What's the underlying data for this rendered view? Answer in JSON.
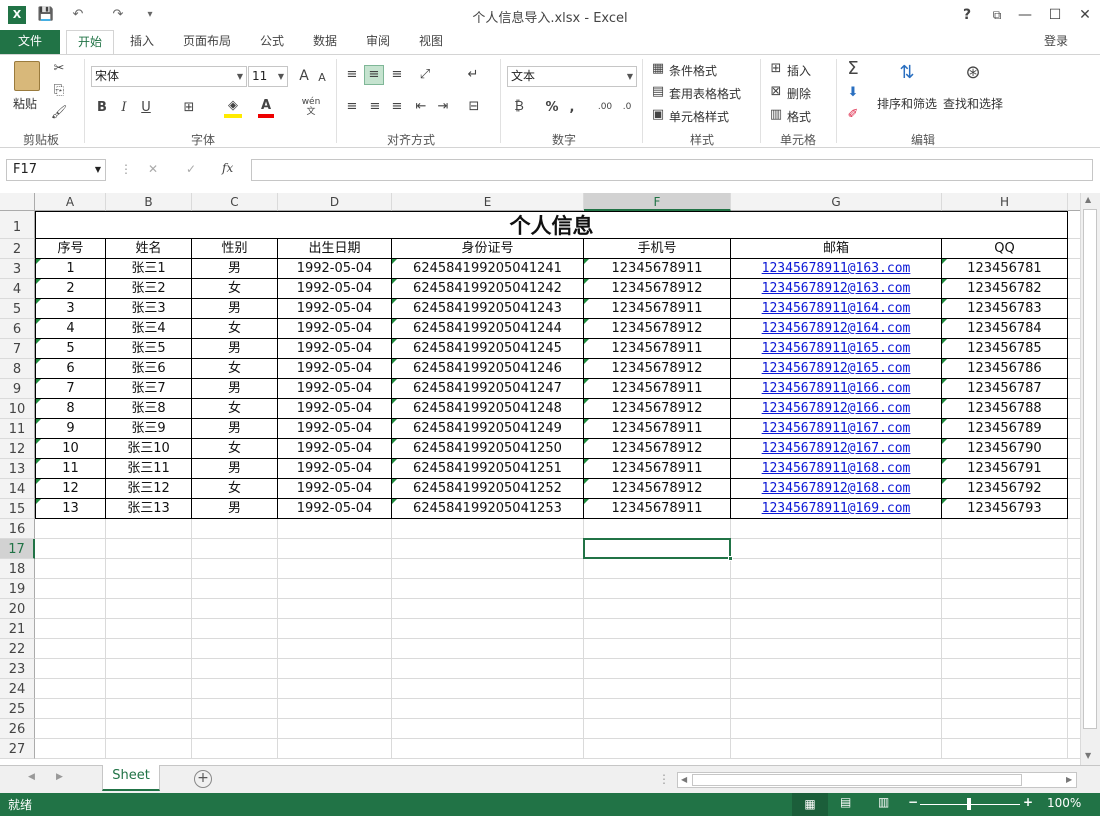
{
  "window": {
    "title": "个人信息导入.xlsx - Excel",
    "help": "?",
    "restore_ribbon": "⧉",
    "minimize": "—",
    "maximize": "☐",
    "close": "✕",
    "login": "登录"
  },
  "quick_access": {
    "save": "💾",
    "undo": "↶",
    "redo": "↷",
    "customize": "▾"
  },
  "tabs": [
    "文件",
    "开始",
    "插入",
    "页面布局",
    "公式",
    "数据",
    "审阅",
    "视图"
  ],
  "ribbon": {
    "clipboard": {
      "paste": "粘贴",
      "group": "剪贴板"
    },
    "font": {
      "name": "宋体",
      "size": "11",
      "group": "字体",
      "bold": "B",
      "italic": "I",
      "underline": "U",
      "grow": "A",
      "shrink": "A",
      "wen": "wén文",
      "font_color": "A"
    },
    "alignment": {
      "group": "对齐方式"
    },
    "number": {
      "format": "文本",
      "group": "数字",
      "percent": "%",
      "comma": ","
    },
    "styles": {
      "conditional": "条件格式",
      "table": "套用表格格式",
      "cell_styles": "单元格样式",
      "group": "样式"
    },
    "cells": {
      "insert": "插入",
      "delete": "删除",
      "format": "格式",
      "group": "单元格"
    },
    "editing": {
      "sort_filter": "排序和筛选",
      "find_select": "查找和选择",
      "group": "编辑"
    }
  },
  "formula_bar": {
    "name_box": "F17",
    "fx": "fx",
    "cancel": "✕",
    "enter": "✓",
    "value": ""
  },
  "columns": [
    "A",
    "B",
    "C",
    "D",
    "E",
    "F",
    "G",
    "H"
  ],
  "selected_column": "F",
  "selected_row": 17,
  "rows": [
    1,
    2,
    3,
    4,
    5,
    6,
    7,
    8,
    9,
    10,
    11,
    12,
    13,
    14,
    15,
    16,
    17,
    18,
    19,
    20,
    21,
    22,
    23,
    24,
    25,
    26,
    27
  ],
  "sheet_title": "个人信息",
  "headers": [
    "序号",
    "姓名",
    "性别",
    "出生日期",
    "身份证号",
    "手机号",
    "邮箱",
    "QQ"
  ],
  "records": [
    [
      "1",
      "张三1",
      "男",
      "1992-05-04",
      "624584199205041241",
      "12345678911",
      "12345678911@163.com",
      "123456781"
    ],
    [
      "2",
      "张三2",
      "女",
      "1992-05-04",
      "624584199205041242",
      "12345678912",
      "12345678912@163.com",
      "123456782"
    ],
    [
      "3",
      "张三3",
      "男",
      "1992-05-04",
      "624584199205041243",
      "12345678911",
      "12345678911@164.com",
      "123456783"
    ],
    [
      "4",
      "张三4",
      "女",
      "1992-05-04",
      "624584199205041244",
      "12345678912",
      "12345678912@164.com",
      "123456784"
    ],
    [
      "5",
      "张三5",
      "男",
      "1992-05-04",
      "624584199205041245",
      "12345678911",
      "12345678911@165.com",
      "123456785"
    ],
    [
      "6",
      "张三6",
      "女",
      "1992-05-04",
      "624584199205041246",
      "12345678912",
      "12345678912@165.com",
      "123456786"
    ],
    [
      "7",
      "张三7",
      "男",
      "1992-05-04",
      "624584199205041247",
      "12345678911",
      "12345678911@166.com",
      "123456787"
    ],
    [
      "8",
      "张三8",
      "女",
      "1992-05-04",
      "624584199205041248",
      "12345678912",
      "12345678912@166.com",
      "123456788"
    ],
    [
      "9",
      "张三9",
      "男",
      "1992-05-04",
      "624584199205041249",
      "12345678911",
      "12345678911@167.com",
      "123456789"
    ],
    [
      "10",
      "张三10",
      "女",
      "1992-05-04",
      "624584199205041250",
      "12345678912",
      "12345678912@167.com",
      "123456790"
    ],
    [
      "11",
      "张三11",
      "男",
      "1992-05-04",
      "624584199205041251",
      "12345678911",
      "12345678911@168.com",
      "123456791"
    ],
    [
      "12",
      "张三12",
      "女",
      "1992-05-04",
      "624584199205041252",
      "12345678912",
      "12345678912@168.com",
      "123456792"
    ],
    [
      "13",
      "张三13",
      "男",
      "1992-05-04",
      "624584199205041253",
      "12345678911",
      "12345678911@169.com",
      "123456793"
    ]
  ],
  "sheet_tabs": {
    "active": "Sheet",
    "add": "+"
  },
  "status": {
    "ready": "就绪",
    "zoom": "100%",
    "zoom_out": "−",
    "zoom_in": "+"
  },
  "colors": {
    "accent": "#217346",
    "link": "#0b17d6",
    "error_triangle": "#1e8b3d"
  }
}
